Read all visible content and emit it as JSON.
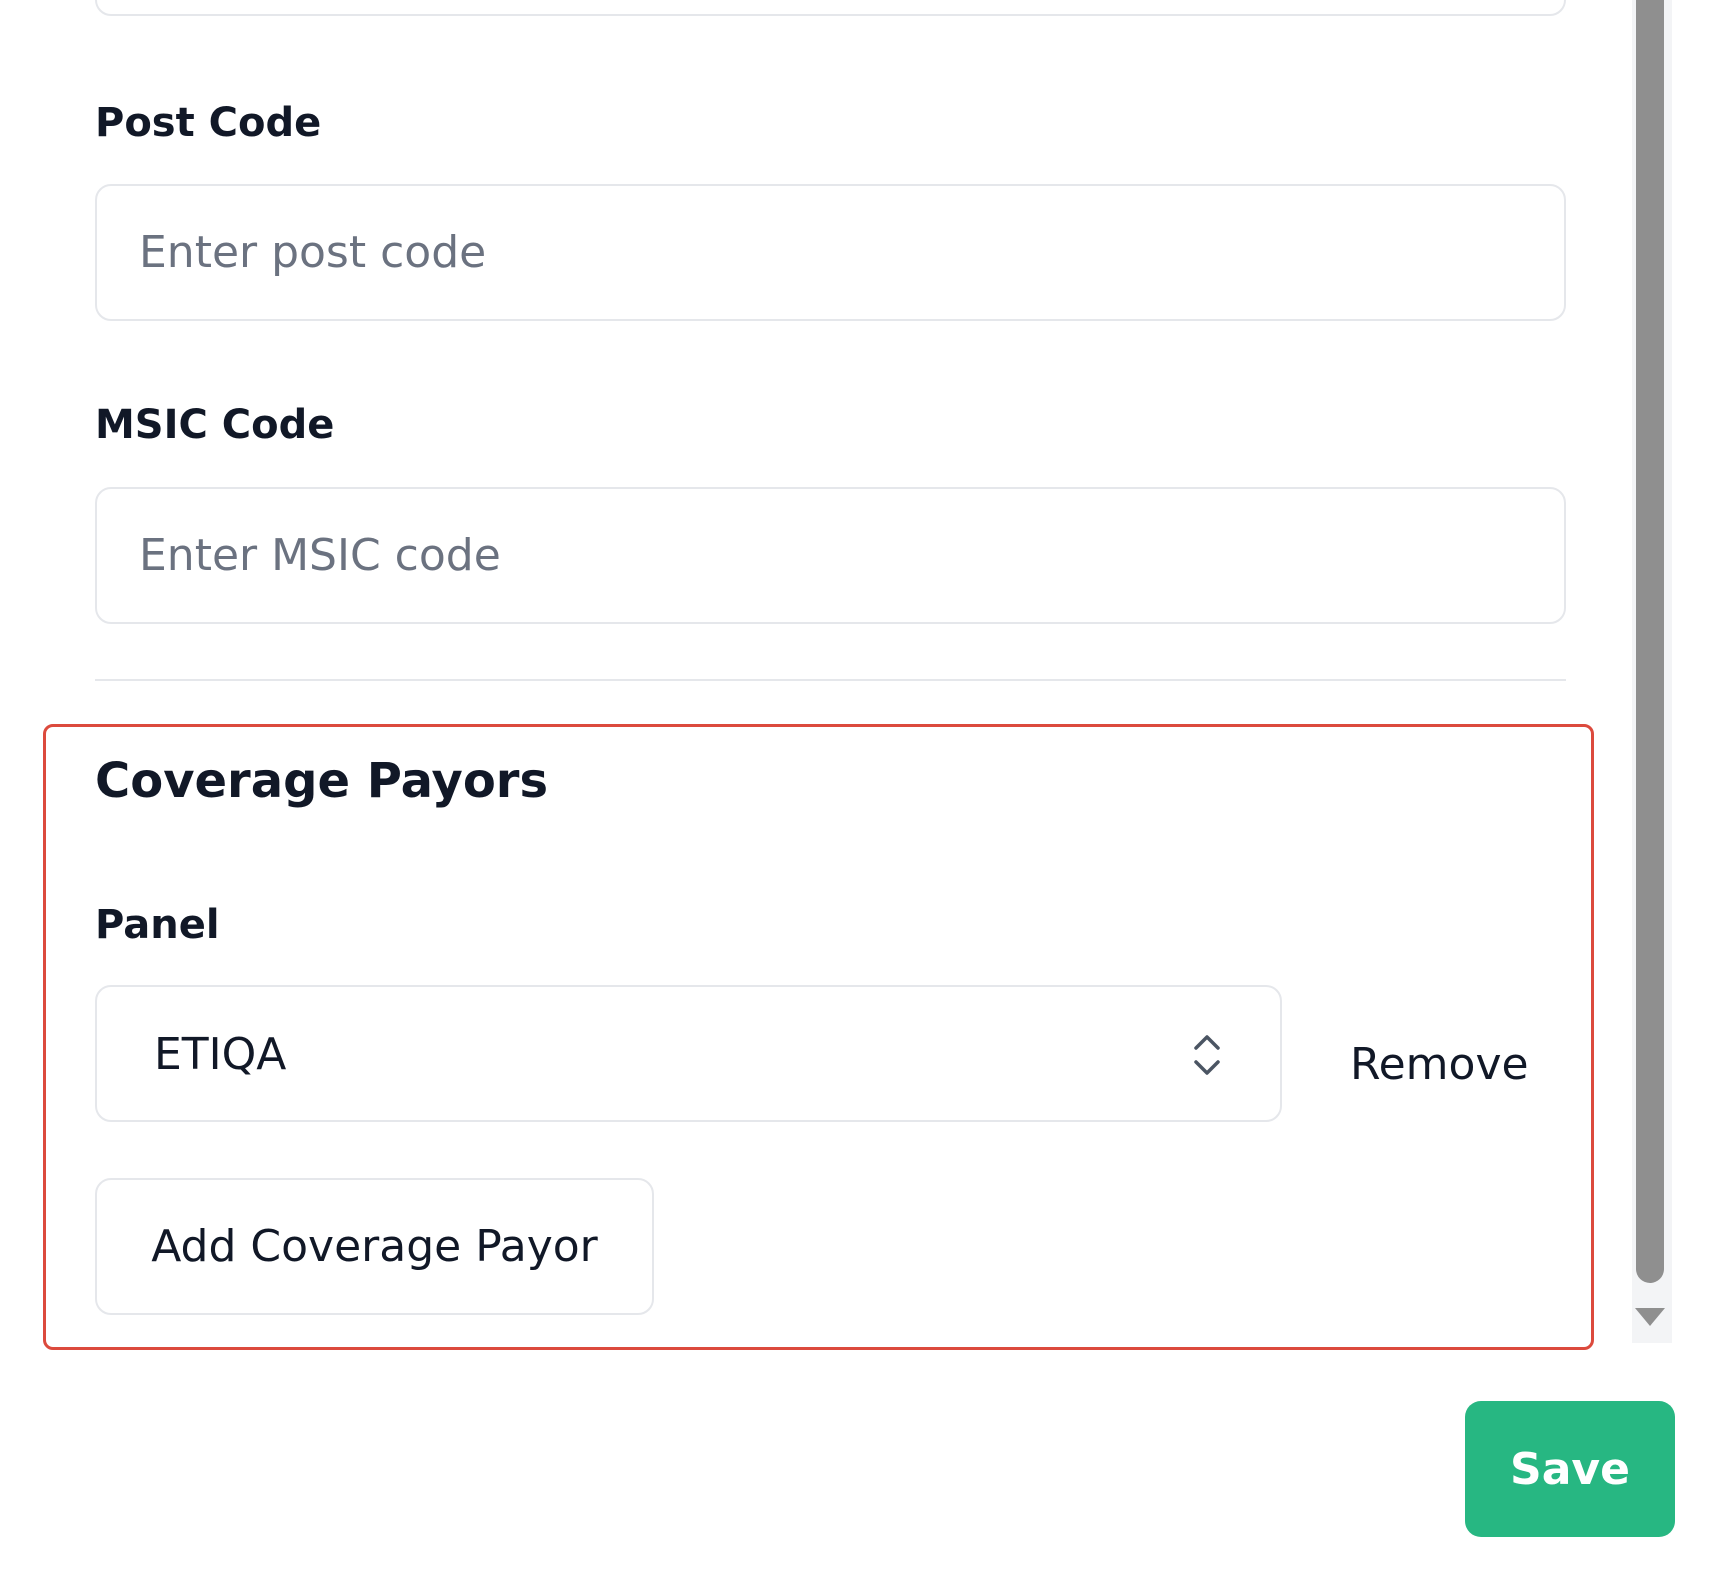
{
  "form": {
    "post_code": {
      "label": "Post Code",
      "placeholder": "Enter post code",
      "value": ""
    },
    "msic_code": {
      "label": "MSIC Code",
      "placeholder": "Enter MSIC code",
      "value": ""
    }
  },
  "coverage_payors": {
    "title": "Coverage Payors",
    "panel_label": "Panel",
    "panel_selected": "ETIQA",
    "remove_label": "Remove",
    "add_label": "Add Coverage Payor",
    "highlight_color": "#dc4a3d"
  },
  "footer": {
    "save_label": "Save",
    "save_color": "#27b782"
  },
  "icons": {
    "select_arrows": "chevron-up-down-icon",
    "scroll_down": "triangle-down-icon"
  }
}
